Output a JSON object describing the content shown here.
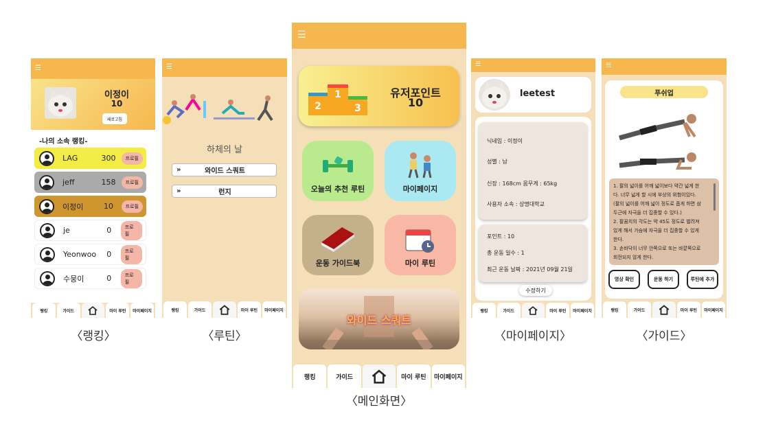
{
  "nav": {
    "ranking": "랭킹",
    "guide": "가이드",
    "my_routine": "마이 루틴",
    "my_page": "마이페이지"
  },
  "captions": {
    "ranking": "〈랭킹〉",
    "routine": "〈루틴〉",
    "main": "〈메인화면〉",
    "mypage": "〈마이페이지〉",
    "guide": "〈가이드〉"
  },
  "ranking": {
    "name": "이정이",
    "points": "10",
    "refresh": "새로고침",
    "section_title": "-나의 소속 랭킹-",
    "profile_label": "프로필",
    "rows": [
      {
        "name": "LAG",
        "points": "300",
        "color": "#f2ec45"
      },
      {
        "name": "jeff",
        "points": "158",
        "color": "#aaaaaa"
      },
      {
        "name": "이정이",
        "points": "10",
        "color": "#cf962f"
      },
      {
        "name": "je",
        "points": "0",
        "color": "#ffffff"
      },
      {
        "name": "Yeonwoo",
        "points": "0",
        "color": "#ffffff"
      },
      {
        "name": "수뭉이",
        "points": "0",
        "color": "#ffffff"
      }
    ]
  },
  "routine": {
    "title": "하체의 날",
    "items": [
      "와이드 스쿼트",
      "런지"
    ],
    "chevron": "»"
  },
  "main": {
    "user_point_label": "유저포인트",
    "user_point_value": "10",
    "podium": [
      "1",
      "2",
      "3"
    ],
    "tiles": {
      "recommend": "오늘의 추천 루틴",
      "mypage": "마이페이지",
      "guidebook": "운동 가이드북",
      "my_routine": "마이 루틴"
    },
    "banner": "와이드 스쿼트"
  },
  "mypage": {
    "username": "leetest",
    "nickname": "닉네임 : 이정이",
    "gender": "성별 : 남",
    "body": "신장 : 168cm 몸무게 : 65kg",
    "org": "사용자 소속 : 상명대학교",
    "points": "포인트 : 10",
    "days": "총 운동 일수 : 1",
    "last": "최근 운동 날짜 : 2021년 09월 21일",
    "edit": "수정하기"
  },
  "guide": {
    "title": "푸쉬업",
    "lines": [
      "1. 팔의 넓이를 어깨 넓이보다 약간 넓게 한",
      "다. 너무 넓게 할 시에 부상의 위험이있다.",
      "(팔의 넓이를 어깨 넓이 정도로 좁게 하면 삼",
      "두근에 자극을 더 집중할 수 있다.)",
      "2. 팔꿈치의 각도는 약 45도 정도로 벌려져",
      "있게 해서 가슴에 자극을 더 집중할 수 있게",
      "한다.",
      "3. 손바닥이 너무 안쪽으로 또는 바깥쪽으로",
      "회전되지 않게 한다."
    ],
    "buttons": [
      "영상 확인",
      "운동 하기",
      "루틴에 추가"
    ]
  },
  "menu_icon": "☰",
  "home_icon": "home-icon"
}
